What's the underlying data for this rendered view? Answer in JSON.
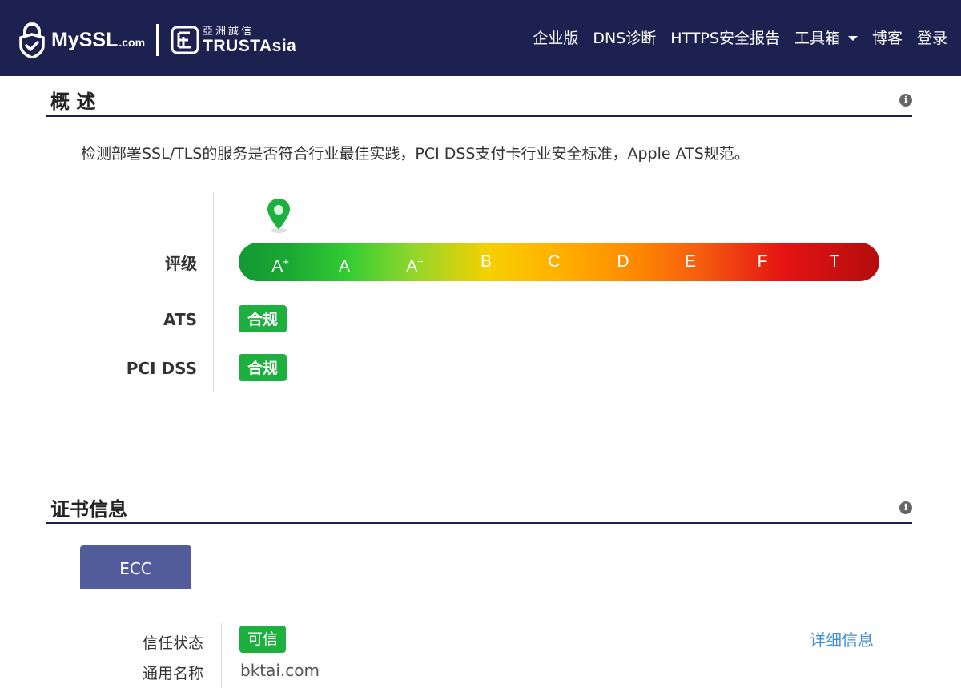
{
  "nav": {
    "brand_main": "MySSL",
    "brand_suffix": ".com",
    "partner_cn": "亞洲誠信",
    "partner_en": "TRUSTAsia",
    "links": [
      "企业版",
      "DNS诊断",
      "HTTPS安全报告",
      "工具箱",
      "博客",
      "登录"
    ]
  },
  "overview": {
    "title": "概 述",
    "description": "检测部署SSL/TLS的服务是否符合行业最佳实践，PCI DSS支付卡行业安全标准，Apple ATS规范。",
    "rating_label": "评级",
    "grades": [
      "A",
      "A",
      "A",
      "B",
      "C",
      "D",
      "E",
      "F",
      "T"
    ],
    "grade_marks": [
      "+",
      "",
      "−",
      "",
      "",
      "",
      "",
      "",
      ""
    ],
    "current_grade_index": 0,
    "ats_label": "ATS",
    "ats_status": "合规",
    "pci_label": "PCI DSS",
    "pci_status": "合规"
  },
  "cert": {
    "title": "证书信息",
    "tab": "ECC",
    "trust_label": "信任状态",
    "trust_value": "可信",
    "detail_link": "详细信息",
    "cn_label": "通用名称",
    "cn_value": "bktai.com"
  },
  "colors": {
    "navbar": "#1c2150",
    "badge_green": "#1db03f",
    "tab": "#535c9a",
    "link": "#3b8fd6"
  }
}
